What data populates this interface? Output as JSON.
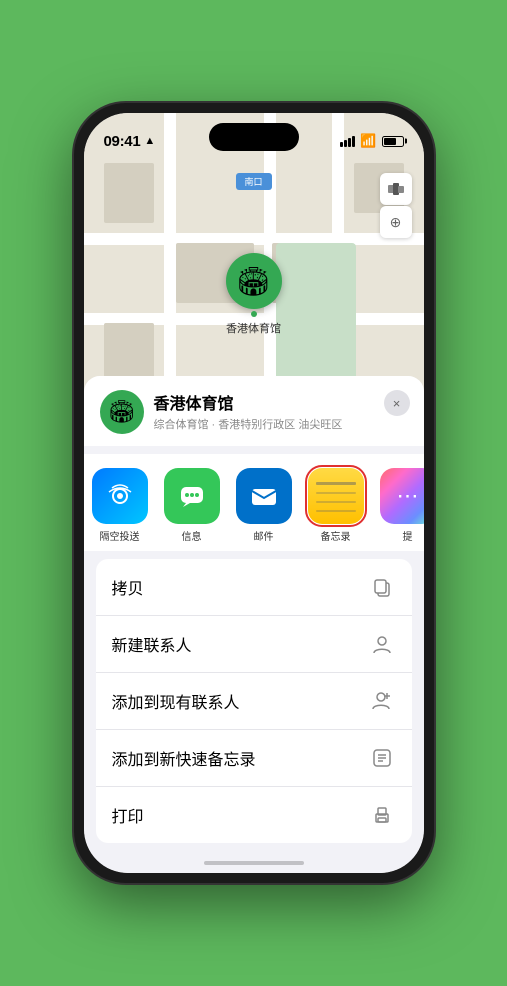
{
  "status_bar": {
    "time": "09:41",
    "direction_icon": "▶"
  },
  "map": {
    "label": "南口",
    "location_name": "香港体育馆",
    "pin_emoji": "🏟️"
  },
  "location_card": {
    "name": "香港体育馆",
    "subtitle": "综合体育馆 · 香港特别行政区 油尖旺区",
    "close_label": "×"
  },
  "share_items": [
    {
      "label": "隔空投送",
      "type": "airdrop"
    },
    {
      "label": "信息",
      "type": "messages"
    },
    {
      "label": "邮件",
      "type": "mail"
    },
    {
      "label": "备忘录",
      "type": "notes",
      "selected": true
    },
    {
      "label": "提",
      "type": "more"
    }
  ],
  "action_items": [
    {
      "label": "拷贝",
      "icon": "copy"
    },
    {
      "label": "新建联系人",
      "icon": "person"
    },
    {
      "label": "添加到现有联系人",
      "icon": "person-add"
    },
    {
      "label": "添加到新快速备忘录",
      "icon": "note"
    },
    {
      "label": "打印",
      "icon": "print"
    }
  ]
}
